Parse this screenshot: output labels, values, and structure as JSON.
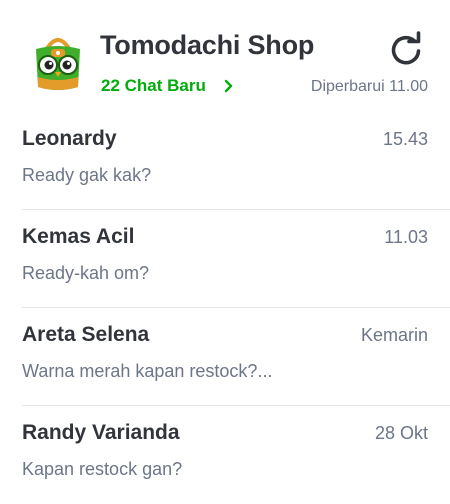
{
  "header": {
    "shop_name": "Tomodachi Shop",
    "new_chat_label": "22 Chat Baru",
    "updated_label": "Diperbarui 11.00",
    "logo_icon": "tokopedia-owl-mascot-icon",
    "refresh_icon": "refresh-icon",
    "chevron_icon": "chevron-right-icon"
  },
  "colors": {
    "accent": "#03ac0e",
    "title": "#31353b",
    "muted": "#6d7588",
    "divider": "#e4e6ea"
  },
  "chats": [
    {
      "name": "Leonardy",
      "time": "15.43",
      "message": "Ready gak kak?"
    },
    {
      "name": "Kemas Acil",
      "time": "11.03",
      "message": "Ready-kah om?"
    },
    {
      "name": "Areta Selena",
      "time": "Kemarin",
      "message": "Warna merah kapan restock?..."
    },
    {
      "name": "Randy Varianda",
      "time": "28 Okt",
      "message": "Kapan restock gan?"
    }
  ]
}
